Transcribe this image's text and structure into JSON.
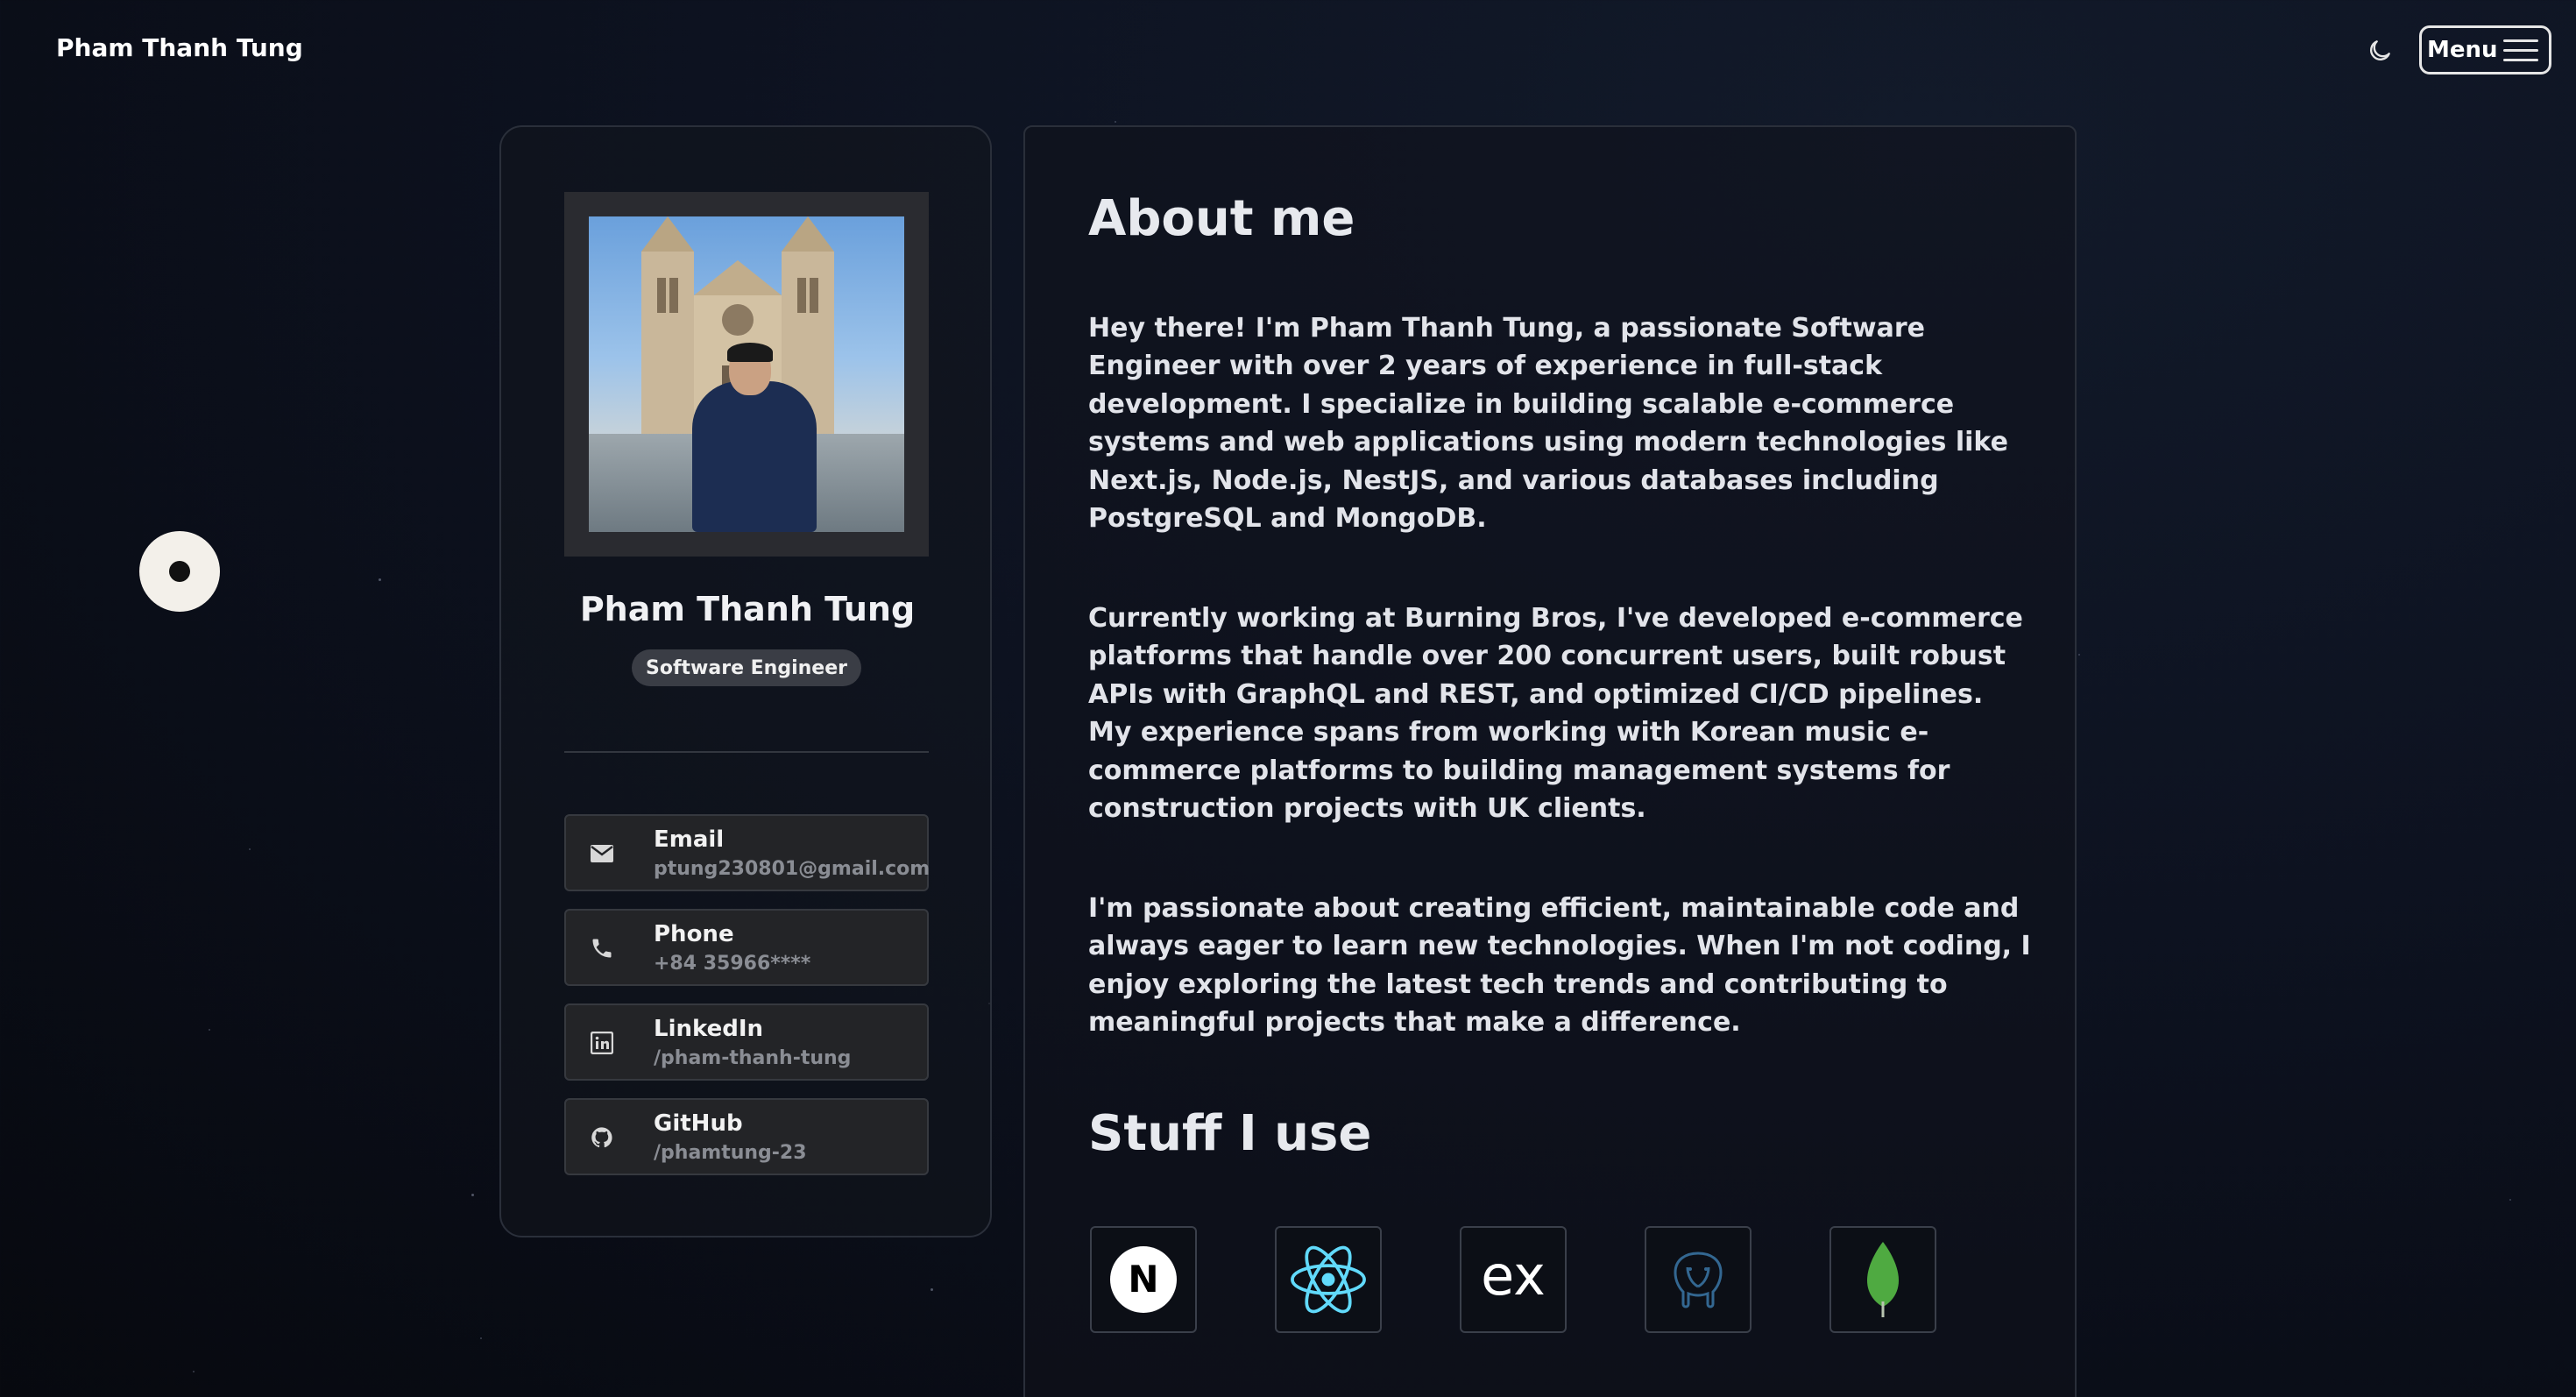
{
  "header": {
    "site_title": "Pham Thanh Tung",
    "theme_toggle_icon": "moon-icon",
    "menu_label": "Menu",
    "menu_icon": "hamburger-icon"
  },
  "profile": {
    "name": "Pham Thanh Tung",
    "role": "Software Engineer",
    "photo": "profile-photo",
    "contacts": [
      {
        "label": "Email",
        "value": "ptung230801@gmail.com",
        "icon": "envelope-icon"
      },
      {
        "label": "Phone",
        "value": "+84 35966****",
        "icon": "phone-icon"
      },
      {
        "label": "LinkedIn",
        "value": "/pham-thanh-tung",
        "icon": "linkedin-icon"
      },
      {
        "label": "GitHub",
        "value": "/phamtung-23",
        "icon": "github-icon"
      }
    ]
  },
  "about": {
    "title": "About me",
    "paragraphs": [
      "Hey there! I'm Pham Thanh Tung, a passionate Software Engineer with over 2 years of experience in full-stack development. I specialize in building scalable e-commerce systems and web applications using modern technologies like Next.js, Node.js, NestJS, and various databases including PostgreSQL and MongoDB.",
      "Currently working at Burning Bros, I've developed e-commerce platforms that handle over 200 concurrent users, built robust APIs with GraphQL and REST, and optimized CI/CD pipelines. My experience spans from working with Korean music e-commerce platforms to building management systems for construction projects with UK clients.",
      "I'm passionate about creating efficient, maintainable code and always eager to learn new technologies. When I'm not coding, I enjoy exploring the latest tech trends and contributing to meaningful projects that make a difference."
    ]
  },
  "stuff": {
    "title": "Stuff I use",
    "tools": [
      {
        "icon": "nextjs-icon",
        "glyph": "N"
      },
      {
        "icon": "react-icon"
      },
      {
        "icon": "express-icon",
        "glyph": "ex"
      },
      {
        "icon": "postgresql-icon"
      },
      {
        "icon": "mongodb-icon"
      }
    ]
  },
  "colors": {
    "background": "#0d1220",
    "card_border": "#2a2f3a",
    "react_blue": "#61dafb",
    "mongodb_green": "#4faa41",
    "postgres_blue": "#336791"
  }
}
